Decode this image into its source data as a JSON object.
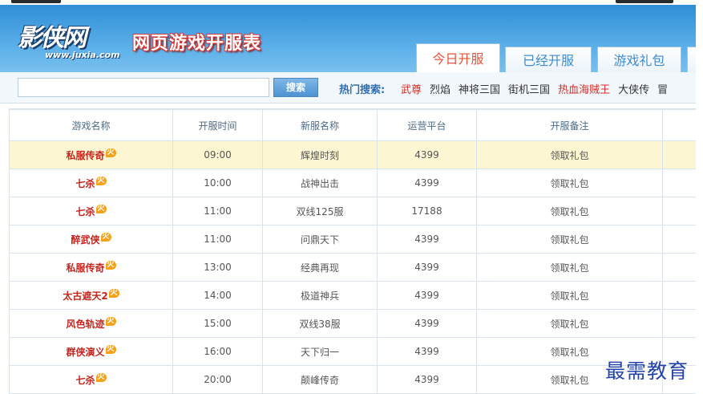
{
  "logo": {
    "text": "影侠网",
    "url": "www.juxia.com"
  },
  "site_title": "网页游戏开服表",
  "tabs": [
    {
      "label": "今日开服",
      "active": true
    },
    {
      "label": "已经开服",
      "active": false
    },
    {
      "label": "游戏礼包",
      "active": false
    }
  ],
  "search": {
    "placeholder": "",
    "button_label": "搜索"
  },
  "hot_search": {
    "label": "热门搜索:",
    "links": [
      {
        "text": "武尊",
        "highlight": true
      },
      {
        "text": "烈焰",
        "highlight": false
      },
      {
        "text": "神将三国",
        "highlight": false
      },
      {
        "text": "街机三国",
        "highlight": false
      },
      {
        "text": "热血海贼王",
        "highlight": true
      },
      {
        "text": "大侠传",
        "highlight": false
      },
      {
        "text": "冒",
        "highlight": false
      }
    ]
  },
  "table": {
    "headers": [
      "游戏名称",
      "开服时间",
      "新服名称",
      "运营平台",
      "开服备注"
    ],
    "badge": "火",
    "rows": [
      {
        "game": "私服传奇",
        "time": "09:00",
        "server": "辉煌时刻",
        "platform": "4399",
        "note": "领取礼包",
        "highlight": true
      },
      {
        "game": "七杀",
        "time": "10:00",
        "server": "战神出击",
        "platform": "4399",
        "note": "领取礼包",
        "highlight": false
      },
      {
        "game": "七杀",
        "time": "11:00",
        "server": "双线125服",
        "platform": "17188",
        "note": "领取礼包",
        "highlight": false
      },
      {
        "game": "醉武侠",
        "time": "11:00",
        "server": "问鼎天下",
        "platform": "4399",
        "note": "领取礼包",
        "highlight": false
      },
      {
        "game": "私服传奇",
        "time": "13:00",
        "server": "经典再现",
        "platform": "4399",
        "note": "领取礼包",
        "highlight": false
      },
      {
        "game": "太古遮天2",
        "time": "14:00",
        "server": "极道神兵",
        "platform": "4399",
        "note": "领取礼包",
        "highlight": false
      },
      {
        "game": "风色轨迹",
        "time": "15:00",
        "server": "双线38服",
        "platform": "4399",
        "note": "领取礼包",
        "highlight": false
      },
      {
        "game": "群侠演义",
        "time": "16:00",
        "server": "天下归一",
        "platform": "4399",
        "note": "领取礼包",
        "highlight": false
      },
      {
        "game": "七杀",
        "time": "20:00",
        "server": "颠峰传奇",
        "platform": "4399",
        "note": "领取礼包",
        "highlight": false
      }
    ]
  },
  "watermark": "最需教育"
}
